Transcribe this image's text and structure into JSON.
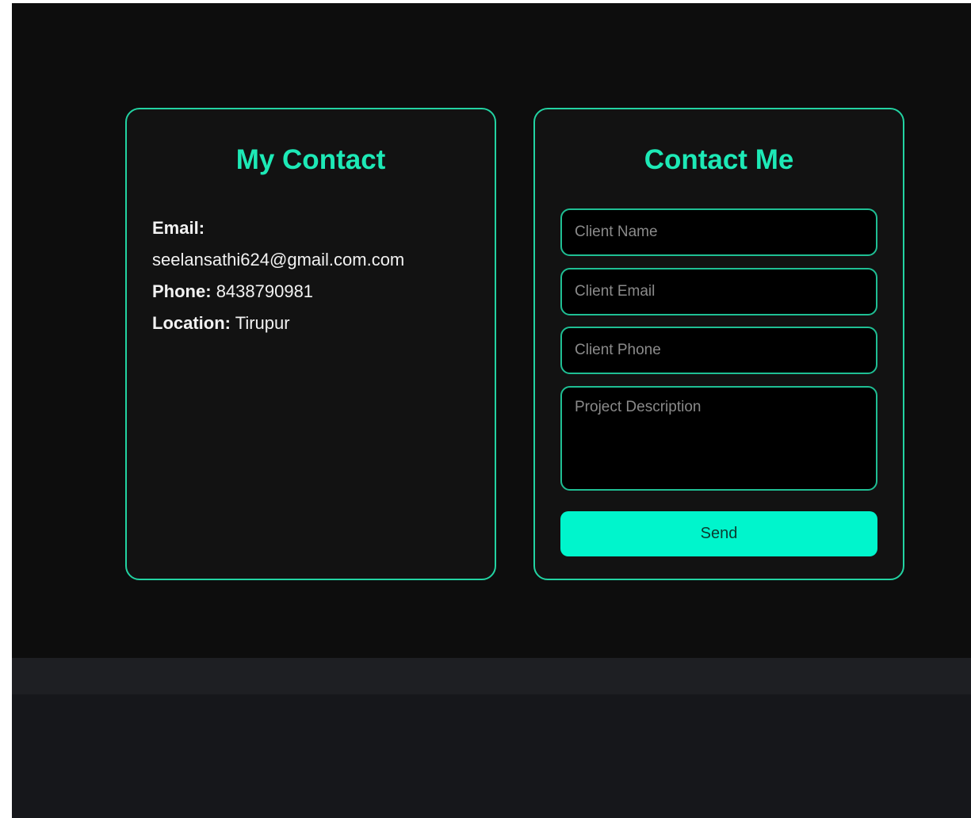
{
  "my_contact": {
    "title": "My Contact",
    "email_label": "Email:",
    "email_value": "seelansathi624@gmail.com.com",
    "phone_label": "Phone:",
    "phone_value": "8438790981",
    "location_label": "Location:",
    "location_value": "Tirupur"
  },
  "contact_form": {
    "title": "Contact Me",
    "name_placeholder": "Client Name",
    "email_placeholder": "Client Email",
    "phone_placeholder": "Client Phone",
    "description_placeholder": "Project Description",
    "send_label": "Send"
  },
  "colors": {
    "accent": "#1de9b6",
    "button": "#00f5cc",
    "background": "#0d0d0d"
  }
}
